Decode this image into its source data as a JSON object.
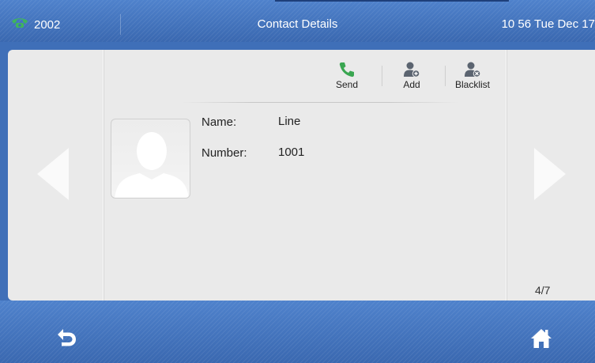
{
  "status_bar": {
    "line_label": "2002",
    "title": "Contact Details",
    "clock": "10 56 Tue Dec 17"
  },
  "actions": {
    "send": "Send",
    "add": "Add",
    "blacklist": "Blacklist"
  },
  "contact": {
    "name_label": "Name:",
    "name_value": "Line",
    "number_label": "Number:",
    "number_value": "1001"
  },
  "pager": {
    "indicator": "4/7"
  },
  "icons": {
    "line": "phone-handset-icon",
    "send": "phone-call-icon",
    "add": "add-contact-icon",
    "blacklist": "blacklist-contact-icon",
    "back": "back-arrow-icon",
    "home": "home-icon",
    "prev": "previous-arrow-icon",
    "next": "next-arrow-icon"
  },
  "colors": {
    "bar_blue": "#3f6fb8",
    "panel_gray": "#eaeaea",
    "accent_green": "#3aa651"
  }
}
